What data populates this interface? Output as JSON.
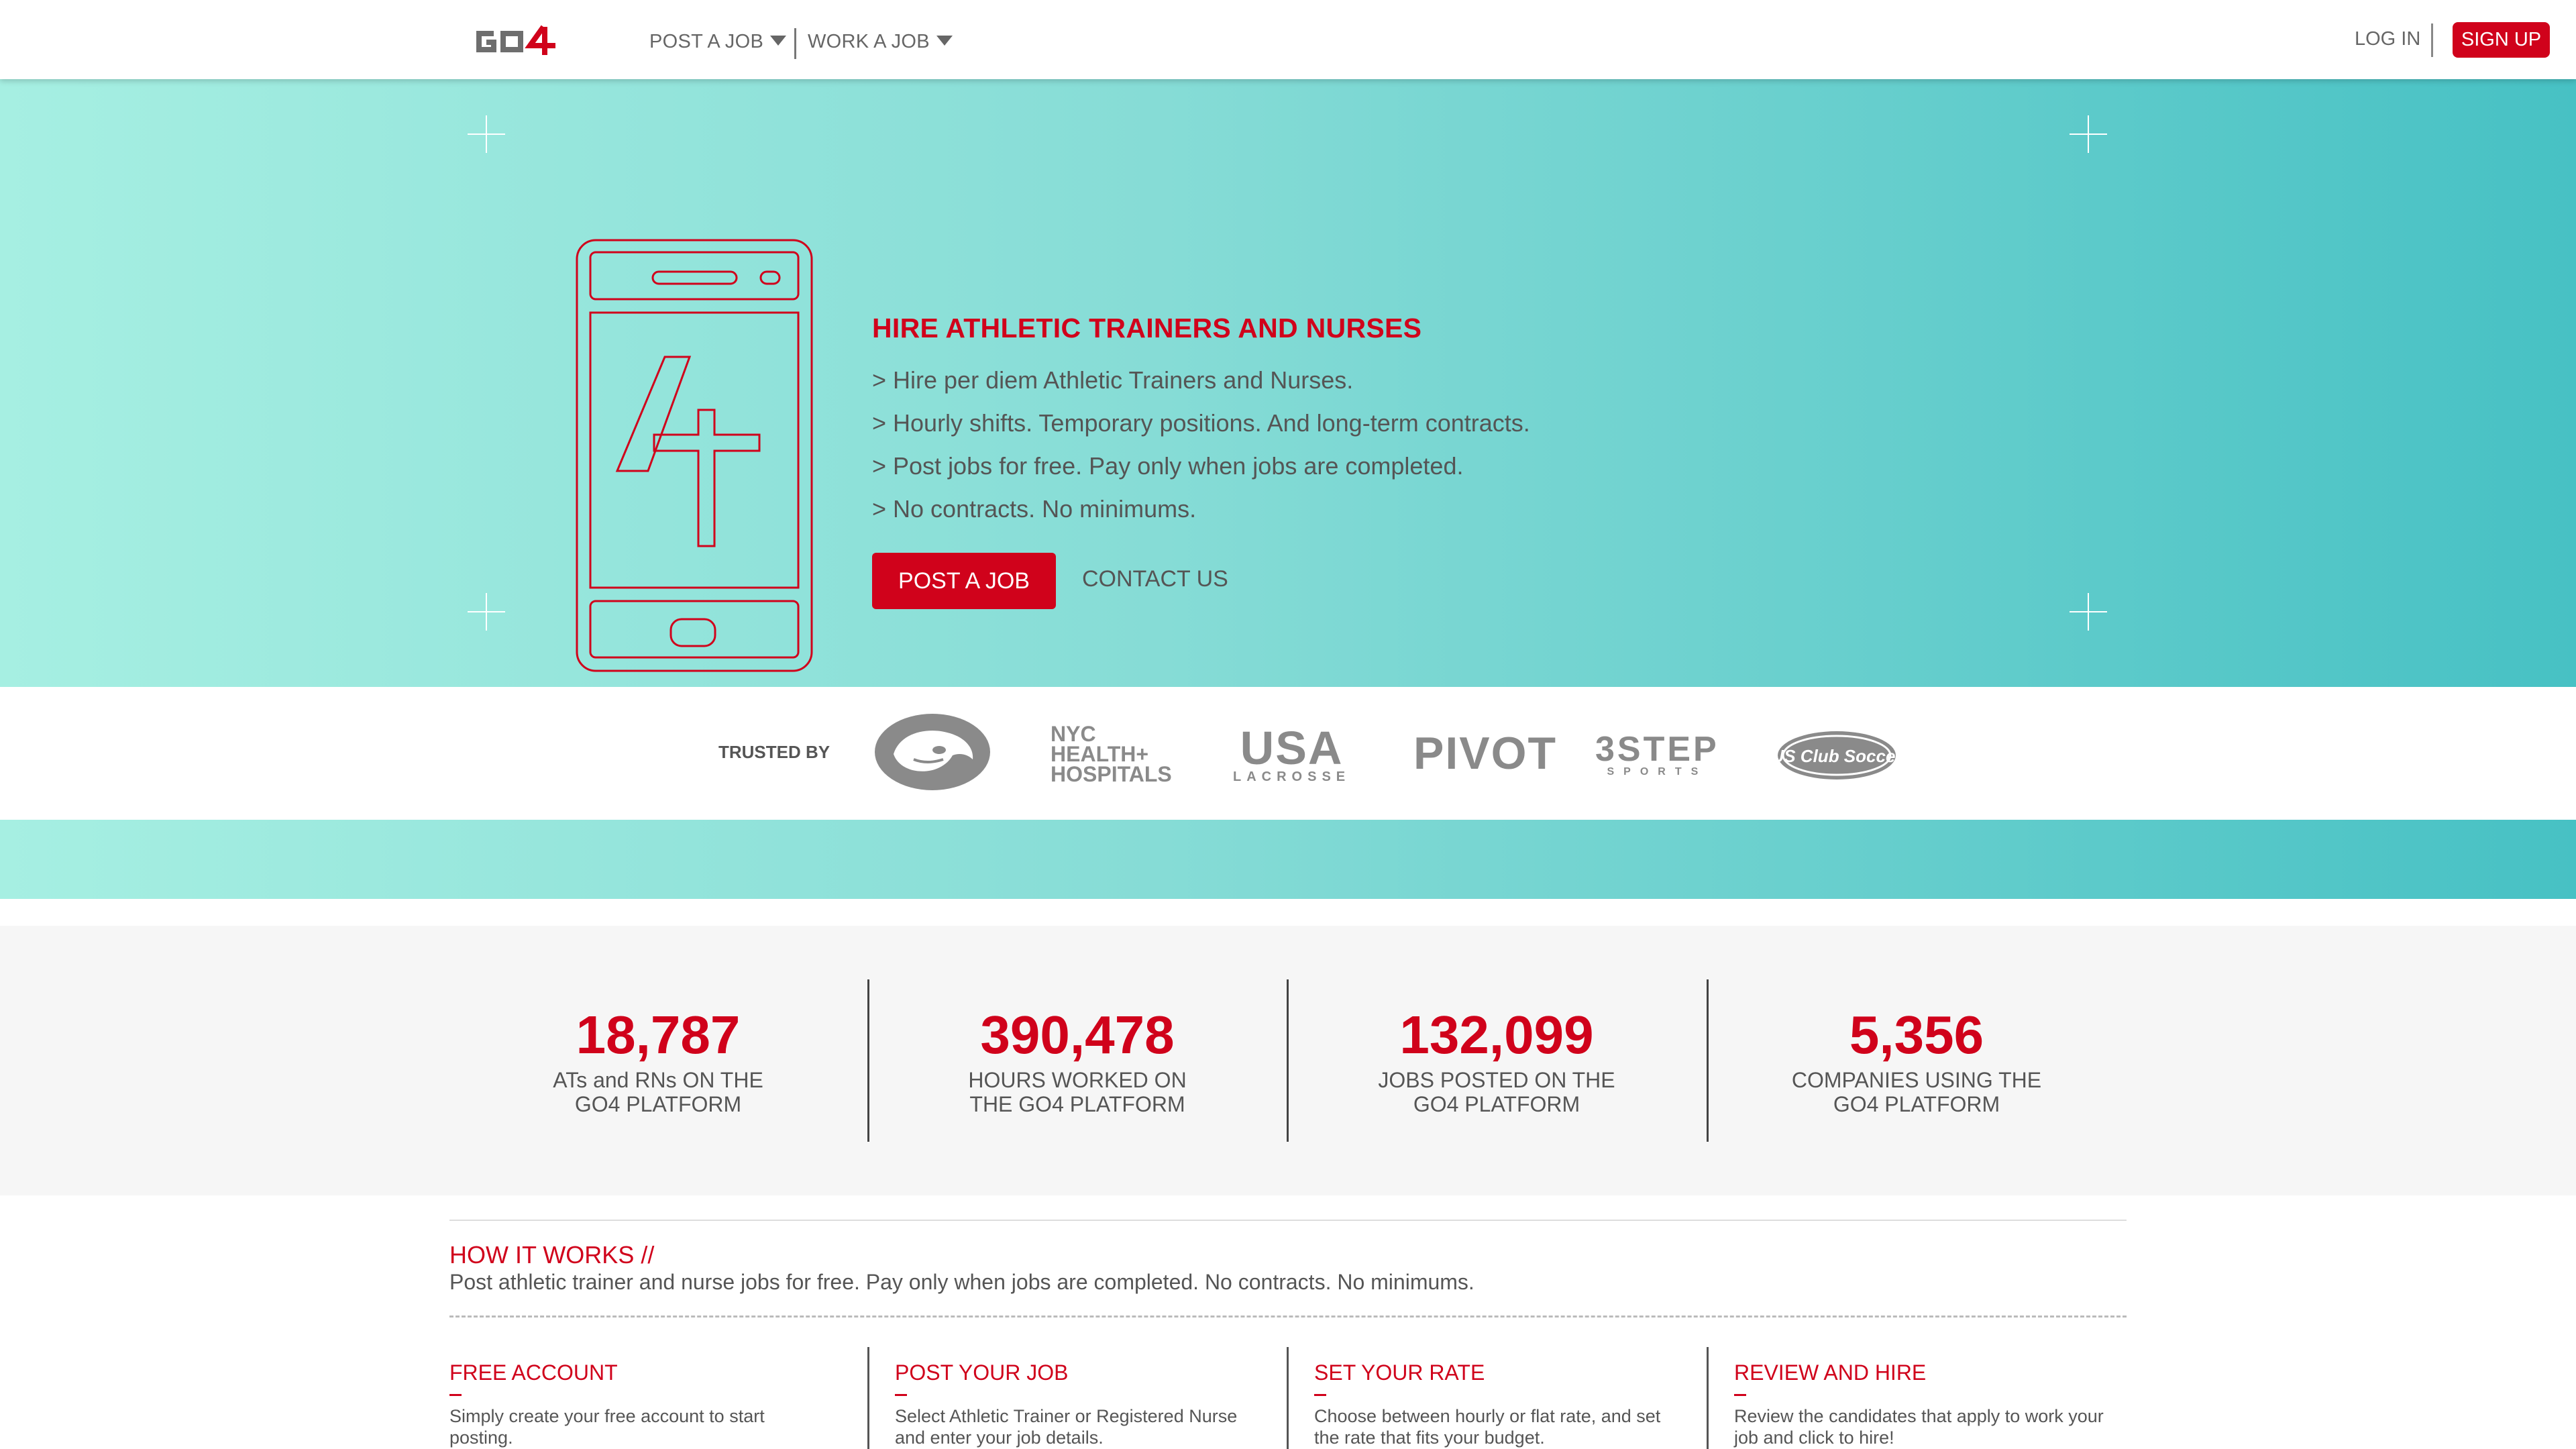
{
  "header": {
    "nav": [
      {
        "label": "POST A JOB"
      },
      {
        "label": "WORK A JOB"
      }
    ],
    "login_label": "LOG IN",
    "signup_label": "SIGN UP"
  },
  "hero": {
    "title": "HIRE ATHLETIC TRAINERS AND NURSES",
    "bullets": [
      "> Hire per diem Athletic Trainers and Nurses.",
      "> Hourly shifts. Temporary positions. And long-term contracts.",
      "> Post jobs for free. Pay only when jobs are completed.",
      "> No contracts. No minimums."
    ],
    "cta_label": "POST A JOB",
    "contact_label": "CONTACT US"
  },
  "trusted": {
    "label": "TRUSTED BY",
    "logos": {
      "nyc": [
        "NYC",
        "HEALTH+",
        "HOSPITALS"
      ],
      "usa": {
        "big": "USA",
        "small": "LACROSSE"
      },
      "pivot": "PIVOT",
      "step": {
        "big": "3STEP",
        "small": "SPORTS"
      },
      "ussoccer": "US Club Soccer"
    }
  },
  "stats": [
    {
      "value": "18,787",
      "label": "ATs and RNs ON THE\nGO4 PLATFORM"
    },
    {
      "value": "390,478",
      "label": "HOURS WORKED ON\nTHE GO4 PLATFORM"
    },
    {
      "value": "132,099",
      "label": "JOBS POSTED ON THE\nGO4 PLATFORM"
    },
    {
      "value": "5,356",
      "label": "COMPANIES USING THE\nGO4 PLATFORM"
    }
  ],
  "how": {
    "title": "HOW IT WORKS //",
    "subtitle": "Post athletic trainer and nurse jobs for free. Pay only when jobs are completed. No contracts. No minimums.",
    "steps": [
      {
        "title": "FREE ACCOUNT",
        "text": "Simply create your free account to start posting."
      },
      {
        "title": "POST YOUR JOB",
        "text": "Select Athletic Trainer or Registered Nurse and enter your job details."
      },
      {
        "title": "SET YOUR RATE",
        "text": "Choose between hourly or flat rate, and set the rate that fits your budget."
      },
      {
        "title": "REVIEW AND HIRE",
        "text": "Review the candidates that apply to work your job and click to hire!"
      }
    ]
  },
  "colors": {
    "brand_red": "#d0021b",
    "teal_light": "#a6efe2",
    "teal_dark": "#47c1c4",
    "stats_bg": "#f6f6f6"
  }
}
